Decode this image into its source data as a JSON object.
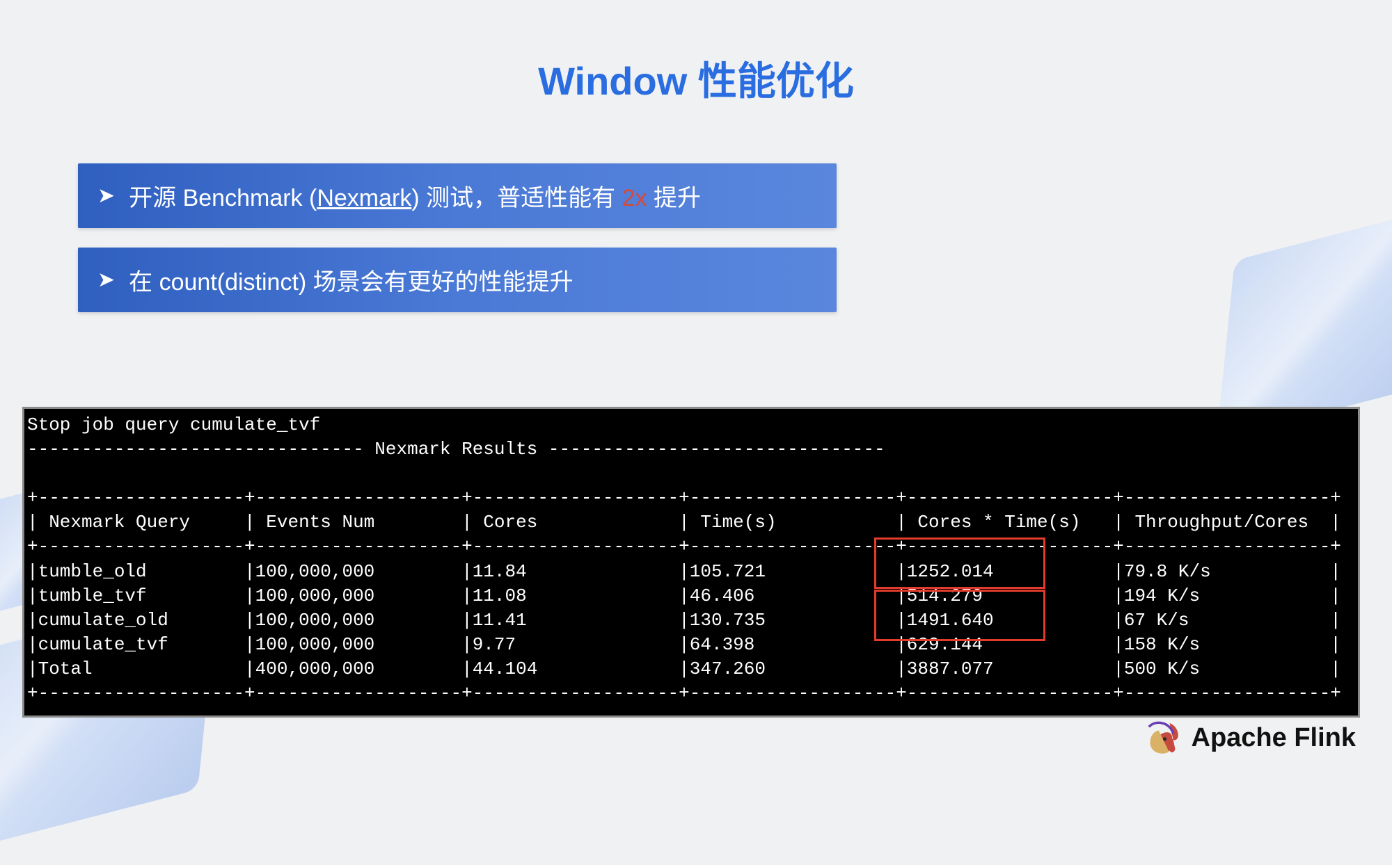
{
  "title": "Window 性能优化",
  "bullets": [
    {
      "pre": "开源 Benchmark (",
      "link": "Nexmark",
      "mid": ") 测试，普适性能有 ",
      "hi": "2x",
      "post": " 提升"
    },
    {
      "text": "在 count(distinct) 场景会有更好的性能提升"
    }
  ],
  "terminal_header": "Stop job query cumulate_tvf",
  "terminal_section": "Nexmark Results",
  "table": {
    "columns": [
      "Nexmark Query",
      "Events Num",
      "Cores",
      "Time(s)",
      "Cores * Time(s)",
      "Throughput/Cores"
    ],
    "rows": [
      [
        "tumble_old",
        "100,000,000",
        "11.84",
        "105.721",
        "1252.014",
        "79.8 K/s"
      ],
      [
        "tumble_tvf",
        "100,000,000",
        "11.08",
        "46.406",
        "514.279",
        "194 K/s"
      ],
      [
        "cumulate_old",
        "100,000,000",
        "11.41",
        "130.735",
        "1491.640",
        "67 K/s"
      ],
      [
        "cumulate_tvf",
        "100,000,000",
        "9.77",
        "64.398",
        "629.144",
        "158 K/s"
      ],
      [
        "Total",
        "400,000,000",
        "44.104",
        "347.260",
        "3887.077",
        "500 K/s"
      ]
    ]
  },
  "footer_brand": "Apache Flink"
}
